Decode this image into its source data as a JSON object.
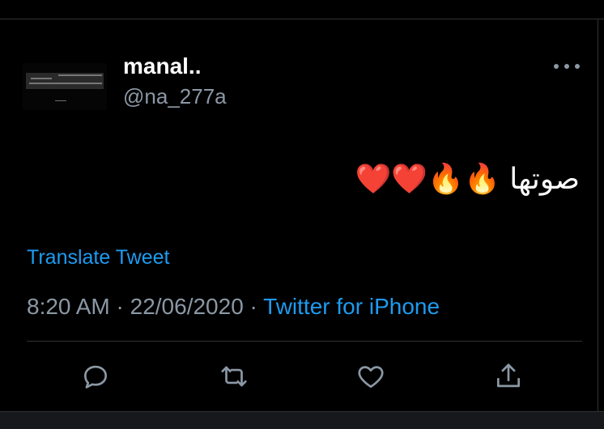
{
  "tweet": {
    "author": {
      "display_name": "manal..",
      "handle": "@na_277a"
    },
    "text": "صوتها 🔥🔥❤️❤️",
    "translate_label": "Translate Tweet",
    "time": "8:20 AM",
    "date": "22/06/2020",
    "separator": "·",
    "source": "Twitter for iPhone"
  },
  "actions": {
    "reply_icon": "speech-bubble-icon",
    "retweet_icon": "retweet-arrows-icon",
    "like_icon": "heart-icon",
    "share_icon": "share-arrow-icon"
  },
  "colors": {
    "background": "#000000",
    "text": "#ffffff",
    "secondary_text": "#8b98a5",
    "link": "#1d9bf0",
    "divider": "#2f3336"
  }
}
